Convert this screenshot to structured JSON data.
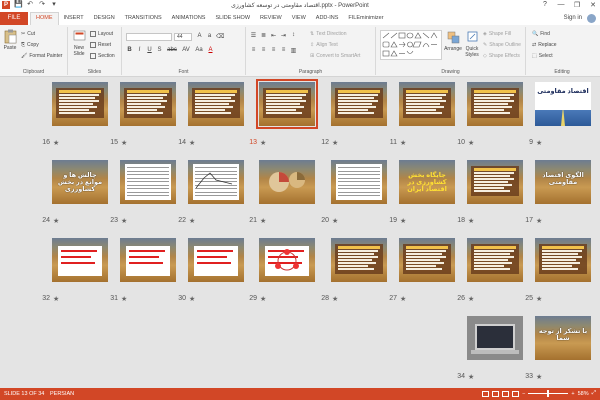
{
  "window": {
    "title": "اقتصاد مقاومتی در توسعه کشاورزی.pptx - PowerPoint",
    "controls": [
      "?",
      "—",
      "❐",
      "✕"
    ]
  },
  "qat": {
    "save": "💾",
    "undo": "↶",
    "redo": "↷",
    "customize": "▾"
  },
  "tabs": {
    "file": "FILE",
    "items": [
      "HOME",
      "INSERT",
      "DESIGN",
      "TRANSITIONS",
      "ANIMATIONS",
      "SLIDE SHOW",
      "REVIEW",
      "VIEW",
      "ADD-INS",
      "FILEminimizer"
    ],
    "active": "HOME",
    "signin": "Sign in"
  },
  "ribbon": {
    "clipboard": {
      "label": "Clipboard",
      "paste": "Paste",
      "cut": "Cut",
      "copy": "Copy",
      "format_painter": "Format Painter"
    },
    "slides": {
      "label": "Slides",
      "new_slide": "New Slide",
      "layout": "Layout",
      "reset": "Reset",
      "section": "Section"
    },
    "font": {
      "label": "Font",
      "size_value": "44",
      "bold": "B",
      "italic": "I",
      "underline": "U",
      "strike": "S",
      "shadow": "abc",
      "spacing": "AV",
      "case": "Aa",
      "color": "A"
    },
    "paragraph": {
      "label": "Paragraph",
      "text_direction": "Text Direction",
      "align_text": "Align Text",
      "smartart": "Convert to SmartArt"
    },
    "drawing": {
      "label": "Drawing",
      "arrange": "Arrange",
      "quick_styles": "Quick Styles",
      "shape_fill": "Shape Fill",
      "shape_outline": "Shape Outline",
      "shape_effects": "Shape Effects"
    },
    "editing": {
      "label": "Editing",
      "find": "Find",
      "replace": "Replace",
      "select": "Select"
    }
  },
  "slides": [
    {
      "n": "9",
      "title": "اقتصاد مقاومتی"
    },
    {
      "n": "10",
      "title": ""
    },
    {
      "n": "11",
      "title": ""
    },
    {
      "n": "12",
      "title": ""
    },
    {
      "n": "13",
      "title": "",
      "selected": true
    },
    {
      "n": "14",
      "title": ""
    },
    {
      "n": "15",
      "title": ""
    },
    {
      "n": "16",
      "title": ""
    },
    {
      "n": "17",
      "title": "الگوی اقتصاد مقاومتی"
    },
    {
      "n": "18",
      "title": ""
    },
    {
      "n": "19",
      "title": "جایگاه بخش کشاورزی در اقتصاد ایران"
    },
    {
      "n": "20",
      "title": ""
    },
    {
      "n": "21",
      "title": ""
    },
    {
      "n": "22",
      "title": ""
    },
    {
      "n": "23",
      "title": ""
    },
    {
      "n": "24",
      "title": "چالش ها و موانع در بخش کشاورزی"
    },
    {
      "n": "25",
      "title": ""
    },
    {
      "n": "26",
      "title": ""
    },
    {
      "n": "27",
      "title": ""
    },
    {
      "n": "28",
      "title": ""
    },
    {
      "n": "29",
      "title": ""
    },
    {
      "n": "30",
      "title": ""
    },
    {
      "n": "31",
      "title": ""
    },
    {
      "n": "32",
      "title": ""
    },
    {
      "n": "33",
      "title": "با تشکر از توجه شما"
    },
    {
      "n": "34",
      "title": ""
    }
  ],
  "star_glyph": "★",
  "status": {
    "slide_info": "SLIDE 13 OF 34",
    "language": "PERSIAN",
    "zoom": "58%",
    "zoom_out": "−",
    "zoom_in": "+"
  },
  "colors": {
    "accent": "#d24726",
    "title_yellow": "#ffe033"
  }
}
